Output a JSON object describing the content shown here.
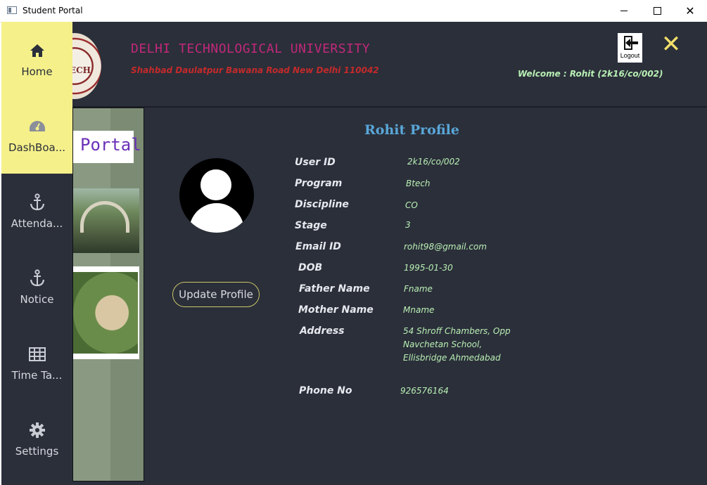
{
  "window": {
    "title": "Student Portal"
  },
  "header": {
    "university": "DELHI TECHNOLOGICAL UNIVERSITY",
    "address": "Shahbad Daulatpur Bawana Road New Delhi 110042",
    "welcome": "Welcome : Rohit (2k16/co/002)",
    "logout_label": "Logout",
    "close_glyph": "✕",
    "seal_text": "TECH"
  },
  "sidebar": {
    "items": [
      {
        "label": "Home",
        "icon": "home-icon"
      },
      {
        "label": "DashBoa...",
        "icon": "dashboard-icon"
      },
      {
        "label": "Attenda...",
        "icon": "anchor-icon"
      },
      {
        "label": "Notice",
        "icon": "anchor-icon"
      },
      {
        "label": "Time Ta...",
        "icon": "table-icon"
      },
      {
        "label": "Settings",
        "icon": "gear-icon"
      }
    ],
    "active_color": "#f5f08a"
  },
  "banner": {
    "portal_text": "Portal"
  },
  "profile": {
    "title": "Rohit Profile",
    "update_button": "Update Profile",
    "fields": [
      {
        "label": "User ID",
        "value": "2k16/co/002"
      },
      {
        "label": "Program",
        "value": "Btech"
      },
      {
        "label": "Discipline",
        "value": "CO"
      },
      {
        "label": "Stage",
        "value": "3"
      },
      {
        "label": "Email ID",
        "value": "rohit98@gmail.com"
      },
      {
        "label": "DOB",
        "value": "1995-01-30"
      },
      {
        "label": "Father Name",
        "value": "Fname"
      },
      {
        "label": "Mother Name",
        "value": "Mname"
      },
      {
        "label": "Address",
        "value_lines": [
          "54  Shroff Chambers, Opp",
          "Navchetan School,",
          "Ellisbridge Ahmedabad"
        ]
      },
      {
        "label": "Phone No",
        "value": "926576164"
      }
    ]
  },
  "colors": {
    "background": "#2b2f3a",
    "title": "#c1287a",
    "address": "#c42a2a",
    "value": "#b9f0b4",
    "profile_title": "#59a7d8",
    "close": "#f3e06a"
  }
}
